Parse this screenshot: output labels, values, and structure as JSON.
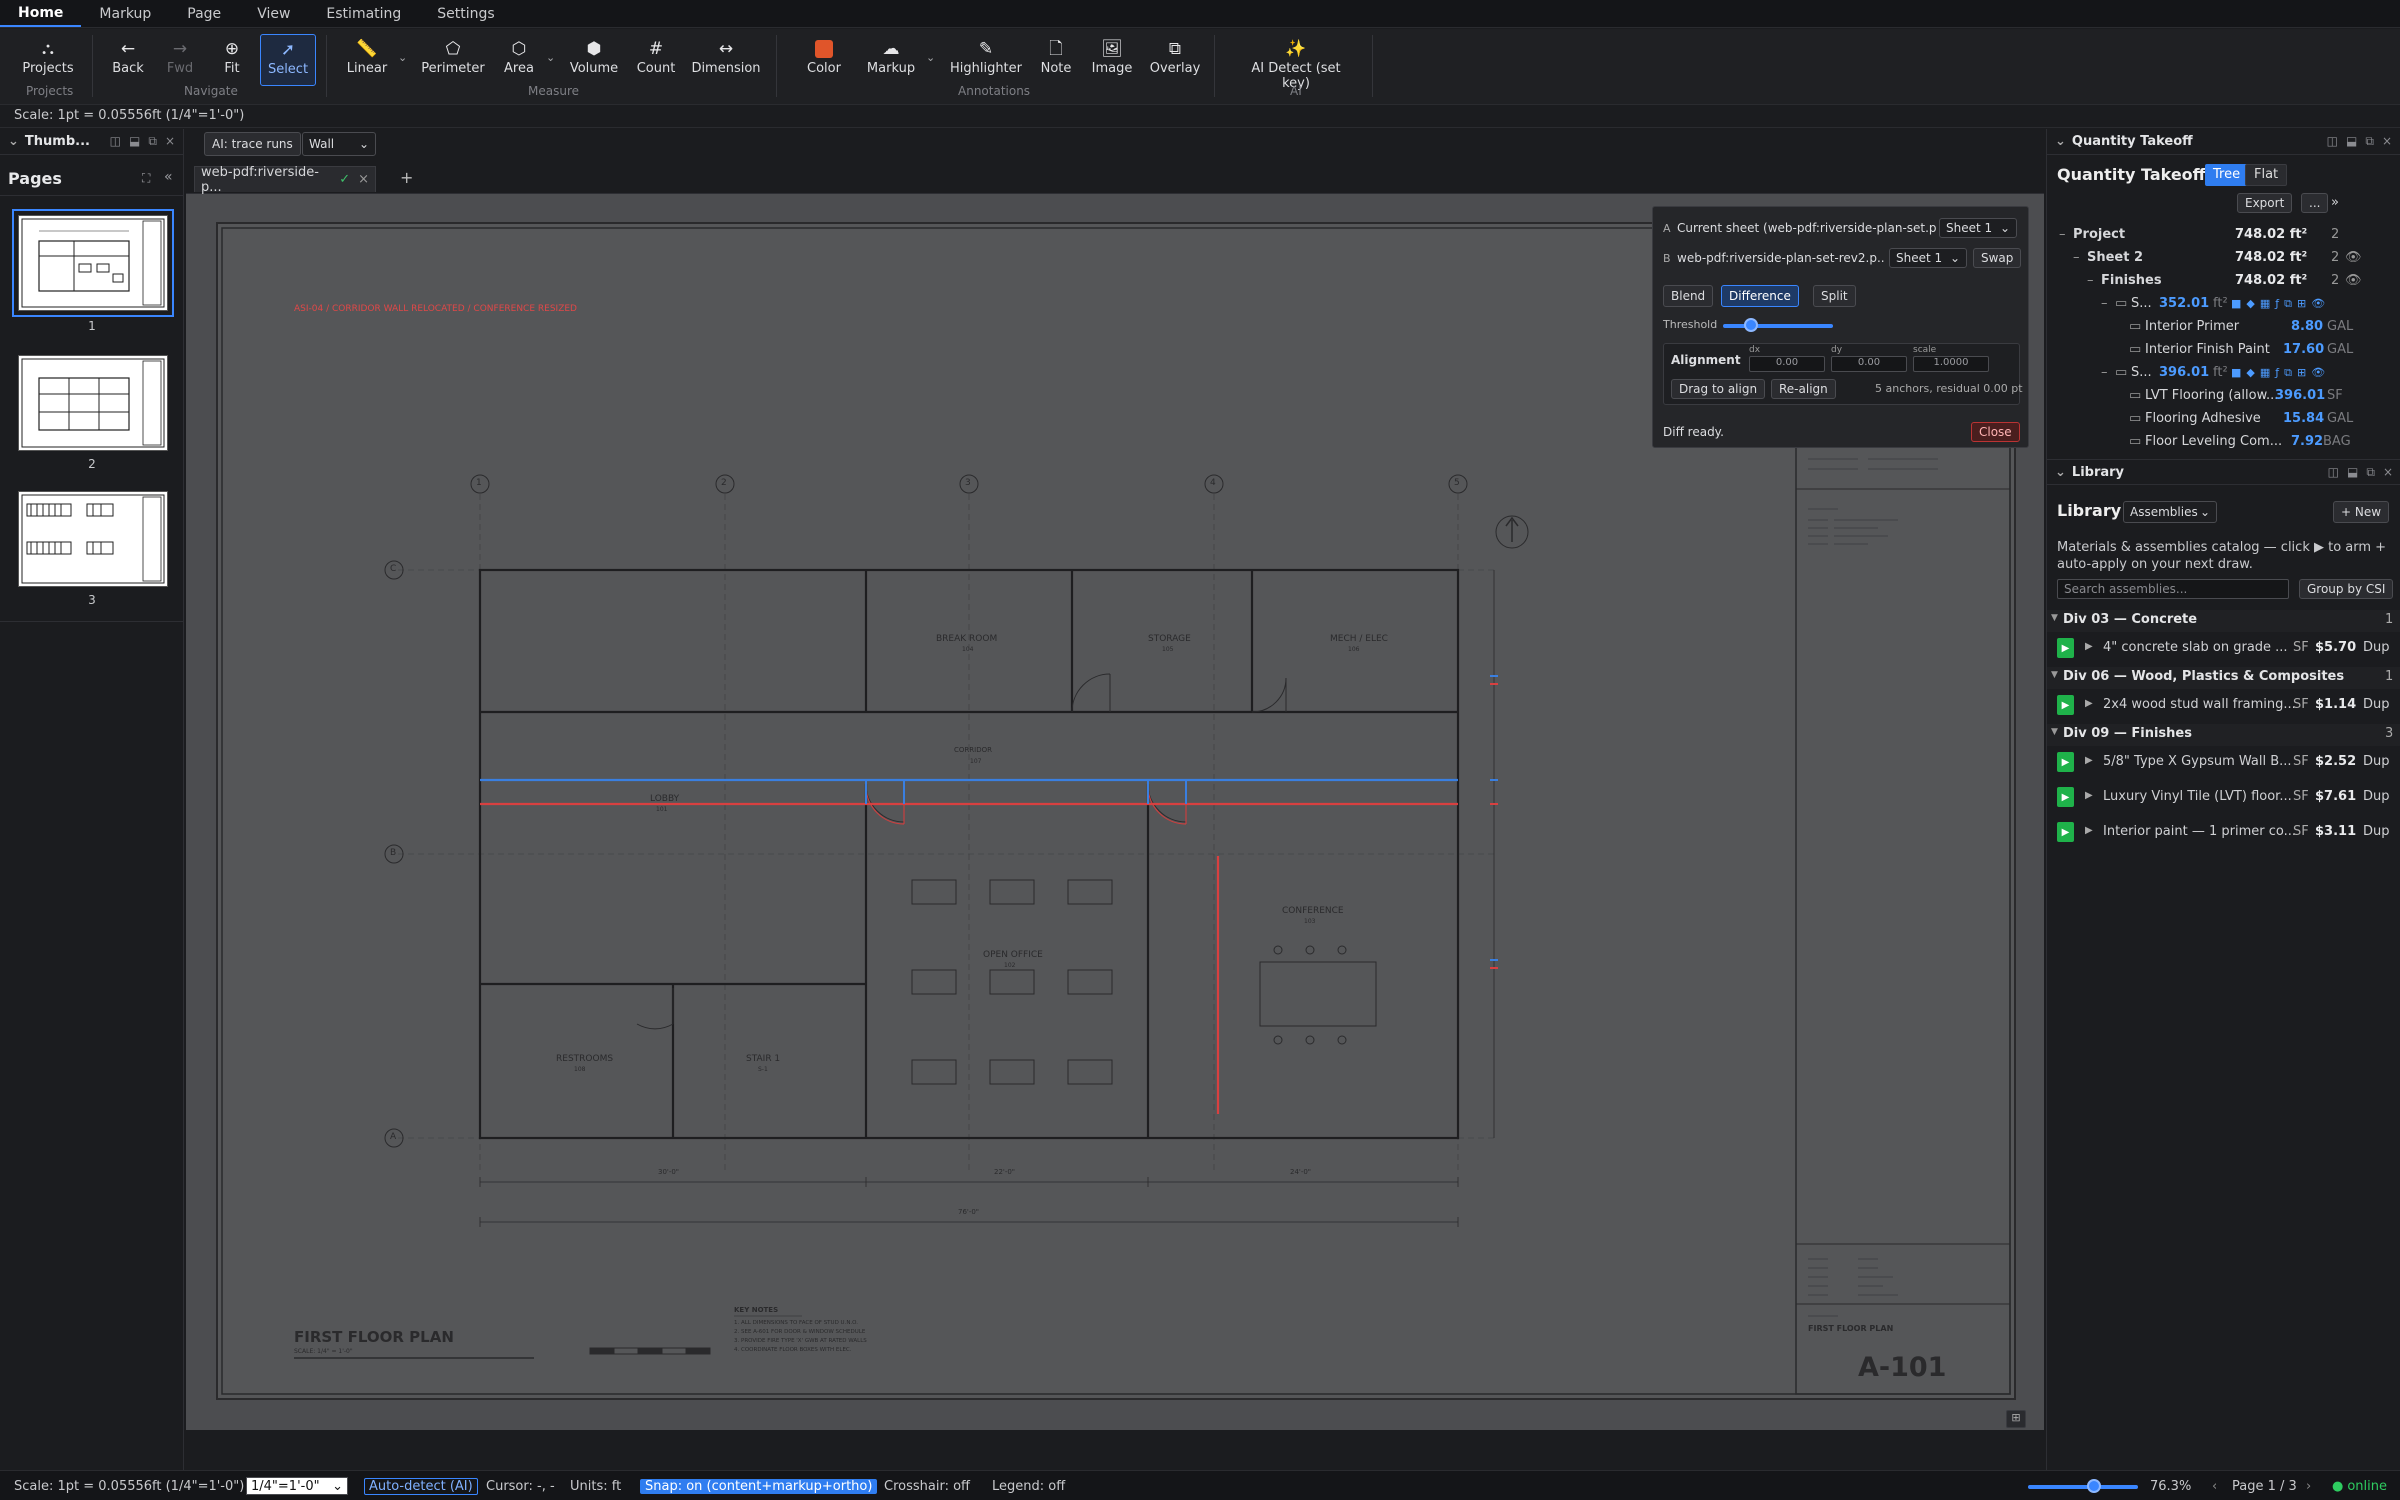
{
  "menu": {
    "tabs": [
      "Home",
      "Markup",
      "Page",
      "View",
      "Estimating",
      "Settings"
    ],
    "active": "Home"
  },
  "ribbon": {
    "projects": {
      "label": "Projects",
      "group": "Projects"
    },
    "navigate": {
      "back": "Back",
      "fwd": "Fwd",
      "fit": "Fit",
      "select": "Select",
      "group": "Navigate"
    },
    "measure": {
      "linear": "Linear",
      "perimeter": "Perimeter",
      "area": "Area",
      "volume": "Volume",
      "count": "Count",
      "dimension": "Dimension",
      "group": "Measure"
    },
    "annotations": {
      "color": "Color",
      "markup": "Markup",
      "highlighter": "Highlighter",
      "note": "Note",
      "image": "Image",
      "overlay": "Overlay",
      "group": "Annotations"
    },
    "ai": {
      "detect": "AI Detect (set key)",
      "group": "AI"
    },
    "color_swatch": "#e0552a"
  },
  "scale_text": "Scale: 1pt = 0.05556ft (1/4\"=1'-0\")",
  "left": {
    "title": "Thumb...",
    "pages_title": "Pages",
    "pages": [
      {
        "num": "1"
      },
      {
        "num": "2"
      },
      {
        "num": "3"
      }
    ]
  },
  "canvas_top": {
    "ai_trace": "AI: trace runs",
    "wall_select": "Wall"
  },
  "doc_tab": {
    "label": "web-pdf:riverside-p...",
    "check": "✓",
    "close": "×",
    "add": "+"
  },
  "sheet": {
    "asi_note": "ASI-04 / CORRIDOR WALL RELOCATED / CONFERENCE RESIZED",
    "grid_cols": [
      "1",
      "2",
      "3",
      "4",
      "5"
    ],
    "grid_rows": [
      "C",
      "B",
      "A"
    ],
    "rooms": {
      "break_room": "BREAK ROOM",
      "break_num": "104",
      "storage": "STORAGE",
      "storage_num": "105",
      "mech": "MECH / ELEC",
      "mech_num": "106",
      "corridor": "CORRIDOR",
      "corridor_num": "107",
      "lobby": "LOBBY",
      "lobby_num": "101",
      "open_office": "OPEN OFFICE",
      "open_office_num": "102",
      "conference": "CONFERENCE",
      "conference_num": "103",
      "restrooms": "RESTROOMS",
      "restrooms_num": "108",
      "stair": "STAIR 1",
      "stair_num": "S-1"
    },
    "dims": [
      "30'-0\"",
      "22'-0\"",
      "24'-0\"",
      "76'-0\""
    ],
    "plan_title": "FIRST FLOOR PLAN",
    "plan_scale": "SCALE: 1/4\" = 1'-0\"",
    "key_notes_title": "KEY NOTES",
    "key_notes": [
      "1. ALL DIMENSIONS TO FACE OF STUD U.N.O.",
      "2. SEE A-601 FOR DOOR & WINDOW SCHEDULE",
      "3. PROVIDE FIRE TYPE 'X' GWB AT RATED WALLS",
      "4. COORDINATE FLOOR BOXES WITH ELEC."
    ],
    "tb_title": "FIRST FLOOR PLAN",
    "tb_number": "A-101"
  },
  "diff": {
    "a_label": "A",
    "a_text": "Current sheet (web-pdf:riverside-plan-set.p...",
    "a_sheet": "Sheet 1",
    "b_label": "B",
    "b_text": "web-pdf:riverside-plan-set-rev2.p...",
    "b_sheet": "Sheet 1",
    "swap": "Swap",
    "modes": [
      "Blend",
      "Difference",
      "Split"
    ],
    "active_mode": "Difference",
    "threshold_label": "Threshold",
    "threshold": 0.25,
    "alignment": "Alignment",
    "dx_label": "dx",
    "dx": "0.00",
    "dy_label": "dy",
    "dy": "0.00",
    "scale_label": "scale",
    "scale": "1.0000",
    "drag": "Drag to align",
    "realign": "Re-align",
    "anchors": "5 anchors, residual 0.00 pt",
    "status": "Diff ready.",
    "close": "Close"
  },
  "qt": {
    "panel_title": "Quantity Takeoff",
    "title": "Quantity Takeoff",
    "tree": "Tree",
    "flat": "Flat",
    "export": "Export",
    "more": "...",
    "next": "»",
    "rows": [
      {
        "name": "Project",
        "value": "748.02 ft²",
        "count": "2"
      },
      {
        "name": "Sheet 2",
        "value": "748.02 ft²",
        "count": "2"
      },
      {
        "name": "Finishes",
        "value": "748.02 ft²",
        "count": "2"
      },
      {
        "name": "S...",
        "value": "352.01",
        "unit": "ft²"
      },
      {
        "name": "Interior Primer",
        "value": "8.80",
        "unit": "GAL"
      },
      {
        "name": "Interior Finish Paint",
        "value": "17.60",
        "unit": "GAL"
      },
      {
        "name": "S...",
        "value": "396.01",
        "unit": "ft²"
      },
      {
        "name": "LVT Flooring (allow...",
        "value": "396.01",
        "unit": "SF"
      },
      {
        "name": "Flooring Adhesive",
        "value": "15.84",
        "unit": "GAL"
      },
      {
        "name": "Floor Leveling Com...",
        "value": "7.92",
        "unit": "BAG"
      }
    ]
  },
  "library": {
    "panel_title": "Library",
    "title": "Library",
    "mode": "Assemblies",
    "new": "+ New",
    "desc": "Materials & assemblies catalog — click ▶ to arm + auto-apply on your next draw.",
    "search_placeholder": "Search assemblies...",
    "group_btn": "Group by CSI",
    "divisions": [
      {
        "name": "Div 03 — Concrete",
        "count": "1",
        "items": [
          {
            "name": "4\" concrete slab on grade ...",
            "unit": "SF",
            "price": "$5.70"
          }
        ]
      },
      {
        "name": "Div 06 — Wood, Plastics & Composites",
        "count": "1",
        "items": [
          {
            "name": "2x4 wood stud wall framing...",
            "unit": "SF",
            "price": "$1.14"
          }
        ]
      },
      {
        "name": "Div 09 — Finishes",
        "count": "3",
        "items": [
          {
            "name": "5/8\" Type X Gypsum Wall B...",
            "unit": "SF",
            "price": "$2.52"
          },
          {
            "name": "Luxury Vinyl Tile (LVT) floor...",
            "unit": "SF",
            "price": "$7.61"
          },
          {
            "name": "Interior paint — 1 primer co...",
            "unit": "SF",
            "price": "$3.11"
          }
        ]
      }
    ],
    "dup": "Dup"
  },
  "status": {
    "scale": "Scale: 1pt = 0.05556ft (1/4\"=1'-0\")",
    "scale_select": "1/4\"=1'-0\"",
    "auto": "Auto-detect (AI)",
    "cursor": "Cursor: -, -",
    "units": "Units: ft",
    "snap": "Snap: on (content+markup+ortho)",
    "crosshair": "Crosshair: off",
    "legend": "Legend: off",
    "zoom": "76.3%",
    "zoom_level": 0.6,
    "page": "Page 1 / 3",
    "online": "online"
  }
}
